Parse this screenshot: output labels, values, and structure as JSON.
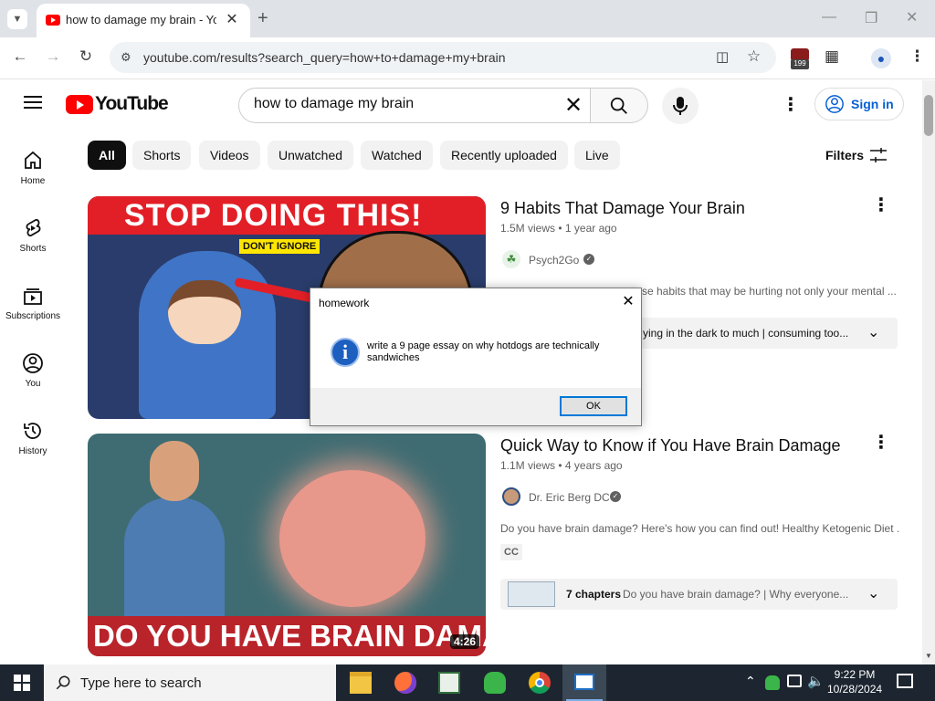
{
  "browser": {
    "tab_title": "how to damage my brain - YouTube",
    "url": "youtube.com/results?search_query=how+to+damage+my+brain",
    "extension_badge": "199"
  },
  "youtube": {
    "logo_text": "YouTube",
    "search_value": "how to damage my brain",
    "sign_in": "Sign in",
    "filters": "Filters"
  },
  "sidebar": {
    "items": [
      {
        "label": "Home"
      },
      {
        "label": "Shorts"
      },
      {
        "label": "Subscriptions"
      },
      {
        "label": "You"
      },
      {
        "label": "History"
      }
    ]
  },
  "chips": [
    "All",
    "Shorts",
    "Videos",
    "Unwatched",
    "Watched",
    "Recently uploaded",
    "Live"
  ],
  "results": [
    {
      "title": "9 Habits That Damage Your Brain",
      "meta": "1.5M views • 1 year ago",
      "channel": "Psych2Go",
      "description_right": "se habits that may be hurting not only your mental ...",
      "chapter_text": "ying in the dark to much | consuming too...",
      "thumb_headline": "STOP DOING THIS!",
      "thumb_badge": "DON'T IGNORE"
    },
    {
      "title": "Quick Way to Know if You Have Brain Damage",
      "meta": "1.1M views • 4 years ago",
      "channel": "Dr. Eric Berg DC",
      "description": "Do you have brain damage? Here's how you can find out! Healthy Ketogenic Diet ...",
      "cc": "CC",
      "chapters_label": "7 chapters",
      "chapters_text": "Do you have brain damage? | Why everyone...",
      "thumb_headline": "DO YOU HAVE BRAIN DAMAGE?",
      "duration": "4:26"
    }
  ],
  "dialog": {
    "title": "homework",
    "message": "write a 9 page essay on why hotdogs are technically sandwiches",
    "ok": "OK"
  },
  "taskbar": {
    "search_placeholder": "Type here to search",
    "time": "9:22 PM",
    "date": "10/28/2024"
  }
}
